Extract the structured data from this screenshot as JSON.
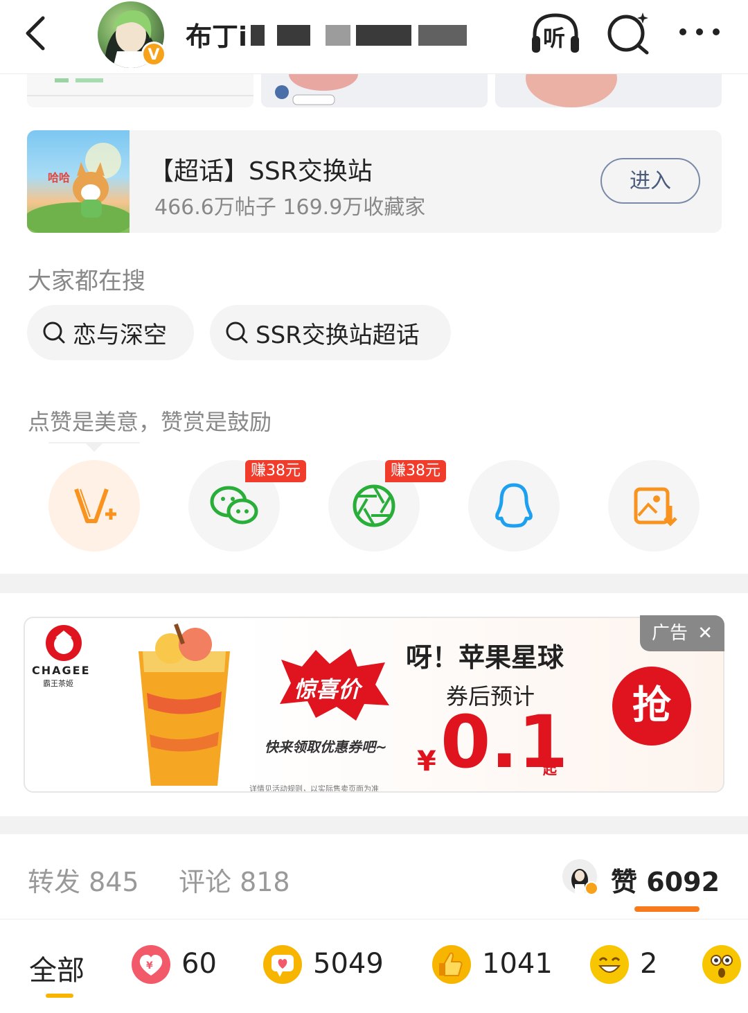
{
  "header": {
    "username": "布丁i",
    "listen_label": "听",
    "verified_badge": "V"
  },
  "super_topic": {
    "title": "【超话】SSR交换站",
    "stats": "466.6万帖子 169.9万收藏家",
    "enter_label": "进入"
  },
  "search": {
    "title": "大家都在搜",
    "chips": [
      "恋与深空",
      "SSR交换站超话"
    ]
  },
  "share": {
    "title": "点赞是美意，赞赏是鼓励",
    "earn_badge": "赚38元"
  },
  "ad": {
    "label": "广告",
    "brand": "CHAGEE",
    "brand_sub": "霸王茶姬",
    "promo_badge": "惊喜价",
    "headline": "呀！苹果星球",
    "subline": "券后预计",
    "currency": "¥",
    "price": "0.1",
    "price_suffix": "起",
    "coupon_text": "快来领取优惠券吧~",
    "fine_print": "详情见活动规则，以实际售卖页面为准",
    "grab_label": "抢"
  },
  "stats": {
    "repost": "转发 845",
    "comment": "评论 818",
    "like_prefix": "赞",
    "like_count": "6092"
  },
  "reactions": {
    "all_label": "全部",
    "items": [
      "60",
      "5049",
      "1041",
      "2"
    ]
  },
  "colors": {
    "accent_orange": "#f77b1d",
    "earn_red": "#f23c2b",
    "ad_red": "#e0141e"
  }
}
